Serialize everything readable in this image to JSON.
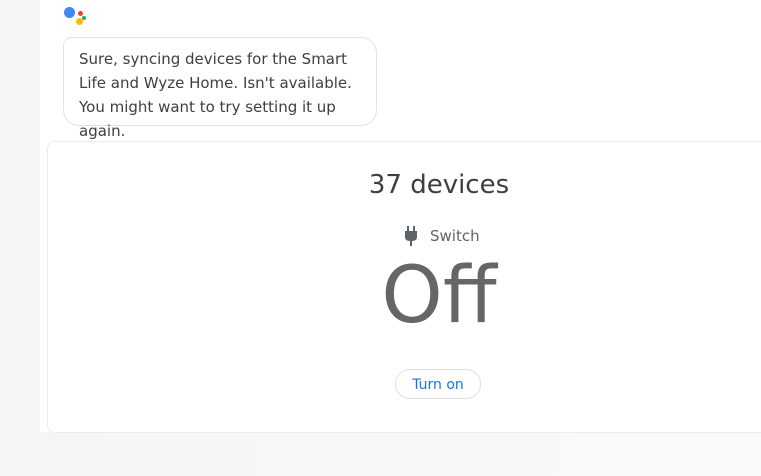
{
  "assistant": {
    "icon": "google-assistant-logo",
    "colors": {
      "blue": "#4285F4",
      "red": "#EA4335",
      "yellow": "#FBBC05",
      "green": "#34A853"
    },
    "message": "Sure, syncing devices for the Smart Life and Wyze Home. Isn't available. You might want to try setting it up again."
  },
  "device_card": {
    "device_count": "37 devices",
    "device_type": {
      "icon": "plug-icon",
      "label": "Switch"
    },
    "state": "Off",
    "action_button": "Turn on",
    "accent_color": "#1a73e8"
  }
}
